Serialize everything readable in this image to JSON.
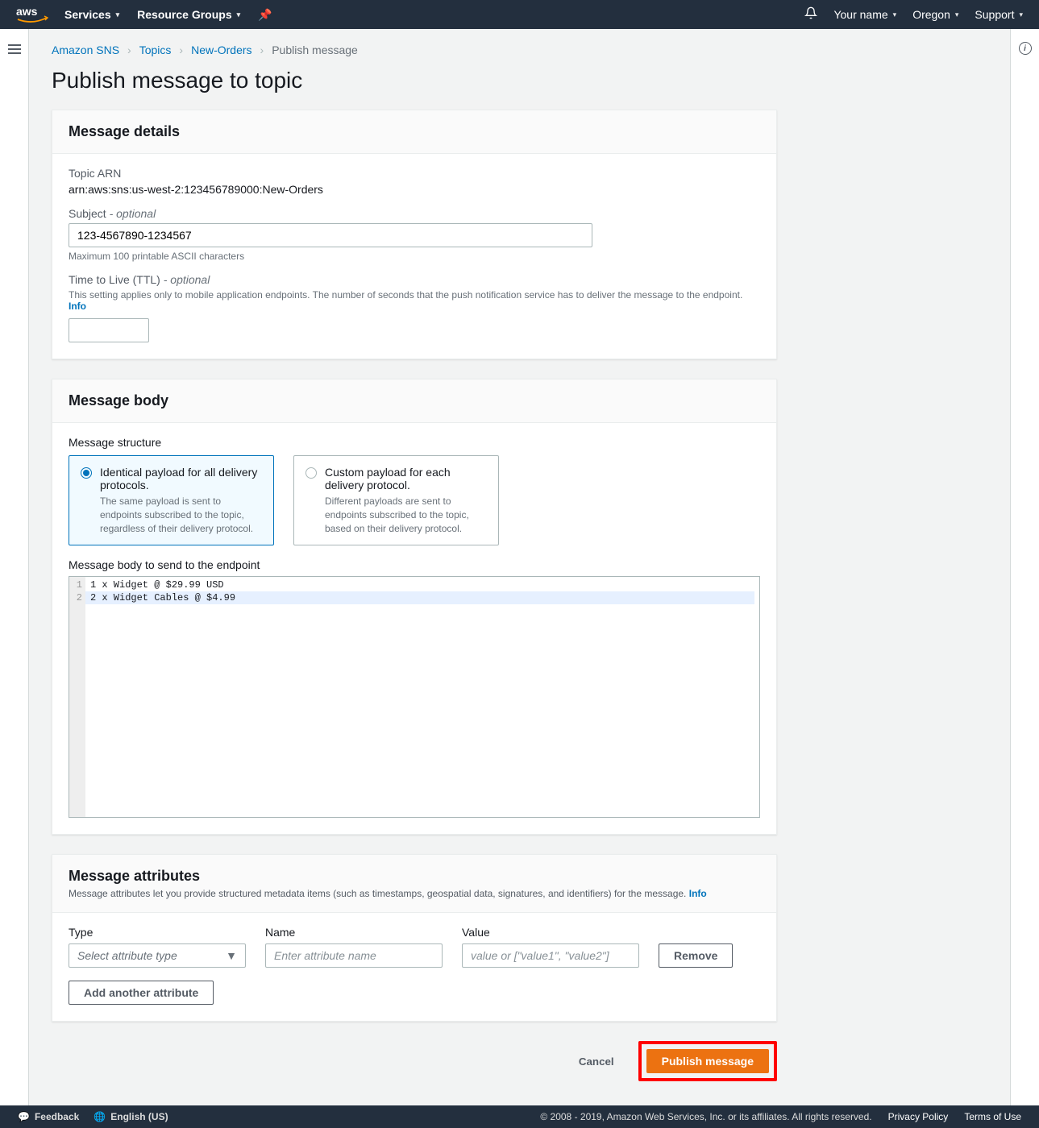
{
  "topnav": {
    "services": "Services",
    "resource_groups": "Resource Groups",
    "your_name": "Your name",
    "region": "Oregon",
    "support": "Support"
  },
  "breadcrumb": {
    "sns": "Amazon SNS",
    "topics": "Topics",
    "topic_name": "New-Orders",
    "current": "Publish message"
  },
  "page_title": "Publish message to topic",
  "message_details": {
    "header": "Message details",
    "arn_label": "Topic ARN",
    "arn_value": "arn:aws:sns:us-west-2:123456789000:New-Orders",
    "subject_label": "Subject",
    "optional": "- optional",
    "subject_value": "123-4567890-1234567",
    "subject_hint": "Maximum 100 printable ASCII characters",
    "ttl_label": "Time to Live (TTL)",
    "ttl_hint": "This setting applies only to mobile application endpoints. The number of seconds that the push notification service has to deliver the message to the endpoint.",
    "info": "Info"
  },
  "message_body": {
    "header": "Message body",
    "structure_label": "Message structure",
    "tile1_title": "Identical payload for all delivery protocols.",
    "tile1_desc": "The same payload is sent to endpoints subscribed to the topic, regardless of their delivery protocol.",
    "tile2_title": "Custom payload for each delivery protocol.",
    "tile2_desc": "Different payloads are sent to endpoints subscribed to the topic, based on their delivery protocol.",
    "body_label": "Message body to send to the endpoint",
    "line1": "1 x Widget @ $29.99 USD",
    "line2": "2 x Widget Cables @ $4.99"
  },
  "attributes": {
    "header": "Message attributes",
    "desc": "Message attributes let you provide structured metadata items (such as timestamps, geospatial data, signatures, and identifiers) for the message.",
    "info": "Info",
    "type_label": "Type",
    "type_placeholder": "Select attribute type",
    "name_label": "Name",
    "name_placeholder": "Enter attribute name",
    "value_label": "Value",
    "value_placeholder": "value or [\"value1\", \"value2\"]",
    "remove": "Remove",
    "add": "Add another attribute"
  },
  "actions": {
    "cancel": "Cancel",
    "publish": "Publish message"
  },
  "footer": {
    "feedback": "Feedback",
    "language": "English (US)",
    "copyright": "© 2008 - 2019, Amazon Web Services, Inc. or its affiliates. All rights reserved.",
    "privacy": "Privacy Policy",
    "terms": "Terms of Use"
  }
}
